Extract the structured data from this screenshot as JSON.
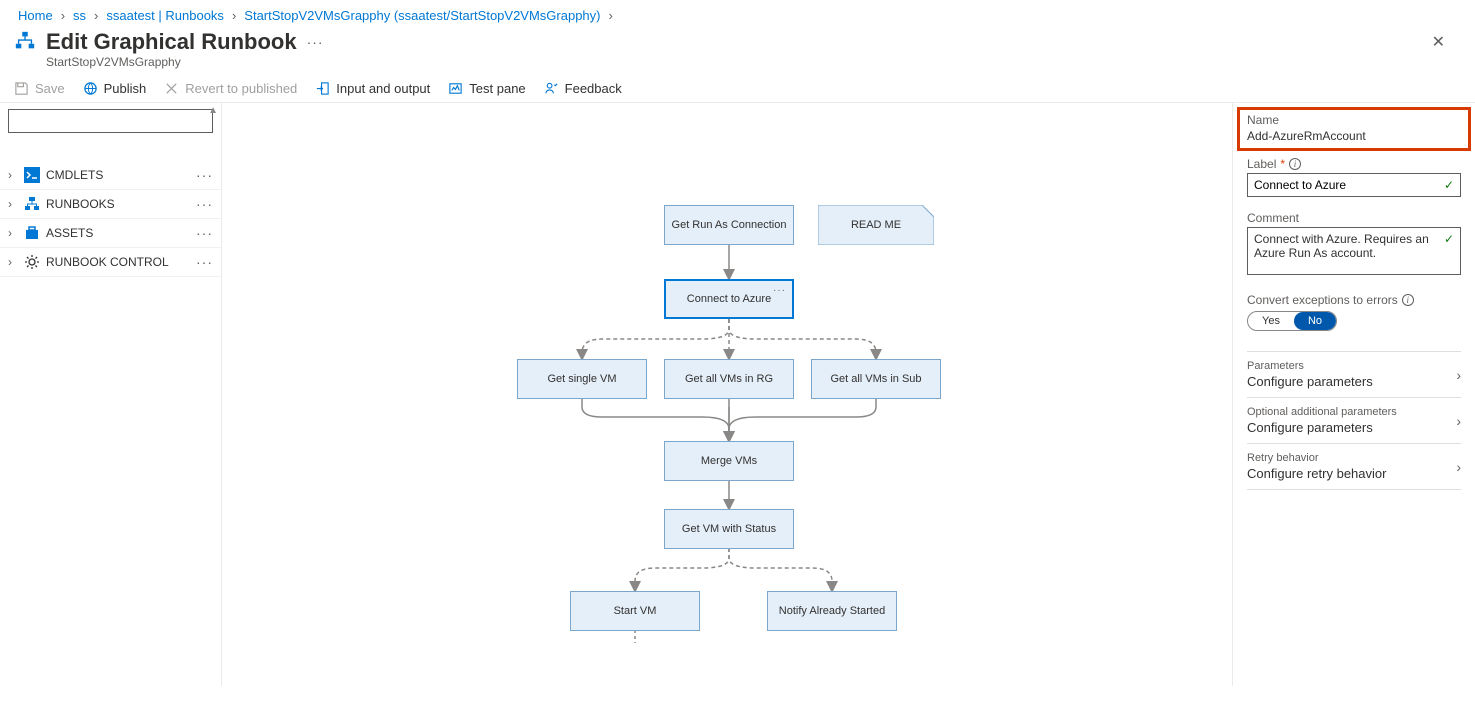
{
  "breadcrumb": {
    "items": [
      "Home",
      "ss",
      "ssaatest | Runbooks",
      "StartStopV2VMsGrapphy (ssaatest/StartStopV2VMsGrapphy)"
    ]
  },
  "header": {
    "title": "Edit Graphical Runbook",
    "subtitle": "StartStopV2VMsGrapphy"
  },
  "toolbar": {
    "save": "Save",
    "publish": "Publish",
    "revert": "Revert to published",
    "io": "Input and output",
    "test": "Test pane",
    "feedback": "Feedback"
  },
  "tree": {
    "items": [
      {
        "label": "CMDLETS"
      },
      {
        "label": "RUNBOOKS"
      },
      {
        "label": "ASSETS"
      },
      {
        "label": "RUNBOOK CONTROL"
      }
    ]
  },
  "nodes": {
    "get_run_as": "Get Run As Connection",
    "readme": "READ ME",
    "connect": "Connect to Azure",
    "single_vm": "Get single VM",
    "all_rg": "Get all VMs in RG",
    "all_sub": "Get all VMs in Sub",
    "merge": "Merge VMs",
    "status": "Get VM with Status",
    "start": "Start VM",
    "notify": "Notify Already Started"
  },
  "props": {
    "name_label": "Name",
    "name_value": "Add-AzureRmAccount",
    "label_label": "Label",
    "label_value": "Connect to Azure",
    "comment_label": "Comment",
    "comment_value": "Connect with Azure.  Requires an Azure Run As account.",
    "convert_label": "Convert exceptions to errors",
    "toggle_yes": "Yes",
    "toggle_no": "No",
    "sections": [
      {
        "hdr": "Parameters",
        "sub": "Configure parameters"
      },
      {
        "hdr": "Optional additional parameters",
        "sub": "Configure parameters"
      },
      {
        "hdr": "Retry behavior",
        "sub": "Configure retry behavior"
      }
    ]
  }
}
